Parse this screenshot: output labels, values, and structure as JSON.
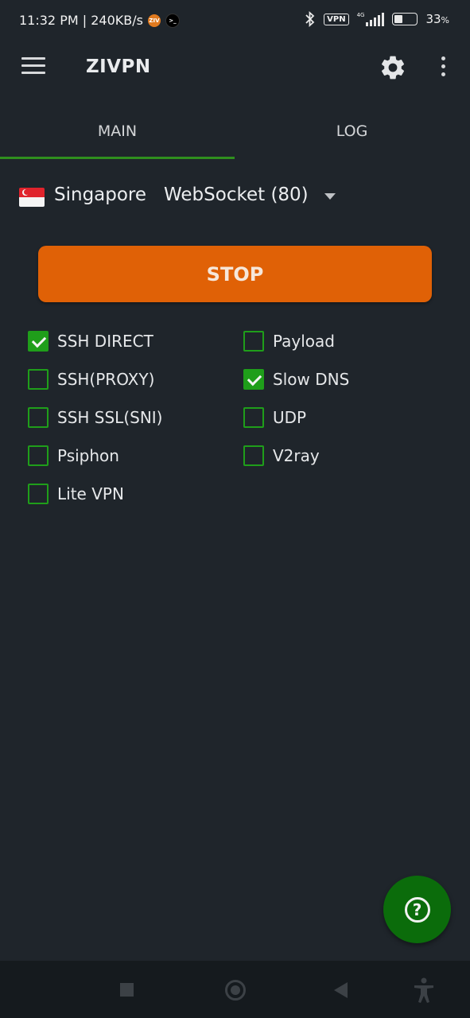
{
  "status_bar": {
    "time_speed": "11:32 PM | 240KB/s",
    "ziv_badge": "ZIV",
    "terminal_badge": ">_",
    "vpn": "VPN",
    "network": "4G",
    "battery": "33",
    "battery_level": 0.33
  },
  "app_bar": {
    "title": "ZIVPN"
  },
  "tabs": [
    {
      "label": "MAIN",
      "selected": true
    },
    {
      "label": "LOG",
      "selected": false
    }
  ],
  "server": {
    "country": "Singapore",
    "protocol": "WebSocket (80)"
  },
  "action_button": "STOP",
  "options": {
    "left": [
      {
        "label": "SSH DIRECT",
        "checked": true
      },
      {
        "label": "SSH(PROXY)",
        "checked": false
      },
      {
        "label": "SSH SSL(SNI)",
        "checked": false
      },
      {
        "label": "Psiphon",
        "checked": false
      },
      {
        "label": "Lite VPN",
        "checked": false
      }
    ],
    "right": [
      {
        "label": "Payload",
        "checked": false
      },
      {
        "label": "Slow DNS",
        "checked": true
      },
      {
        "label": "UDP",
        "checked": false
      },
      {
        "label": "V2ray",
        "checked": false
      }
    ]
  },
  "fab": {
    "symbol": "?"
  },
  "colors": {
    "background": "#1f252b",
    "accent_green": "#1f9e1a",
    "stop_orange": "#e06106",
    "fab_green": "#0b6c0b"
  }
}
